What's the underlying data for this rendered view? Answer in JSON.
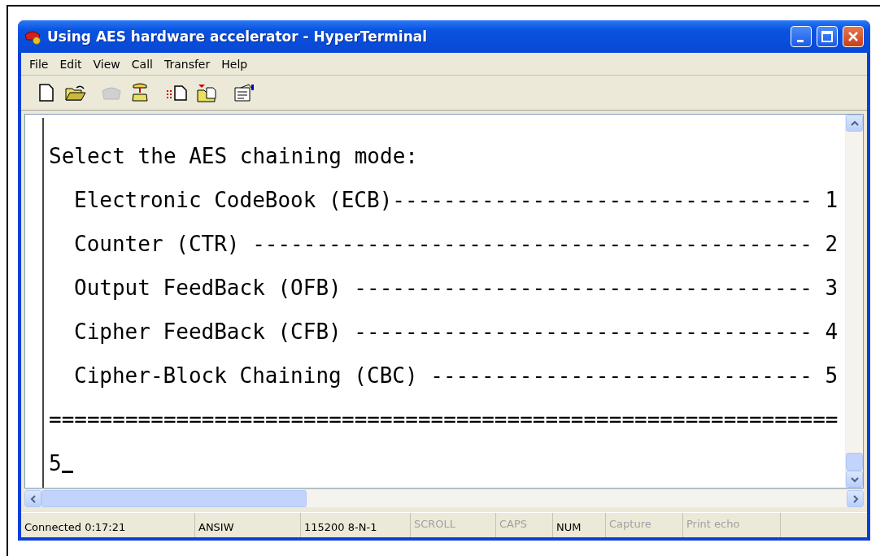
{
  "window": {
    "title": "Using AES hardware accelerator - HyperTerminal"
  },
  "menu": [
    "File",
    "Edit",
    "View",
    "Call",
    "Transfer",
    "Help"
  ],
  "toolbar": [
    {
      "kind": "new",
      "disabled": false
    },
    {
      "kind": "open",
      "disabled": false
    },
    {
      "kind": "disconnect",
      "disabled": true
    },
    {
      "kind": "call",
      "disabled": false
    },
    {
      "kind": "send",
      "disabled": false
    },
    {
      "kind": "receive",
      "disabled": false
    },
    {
      "kind": "properties",
      "disabled": false
    }
  ],
  "terminal": {
    "lines": [
      {
        "kind": "heading",
        "text": "Select the AES chaining mode:"
      },
      {
        "kind": "option",
        "text": "Electronic CodeBook (ECB)--------------------------------- 1"
      },
      {
        "kind": "option",
        "text": "Counter (CTR) -------------------------------------------- 2"
      },
      {
        "kind": "option",
        "text": "Output FeedBack (OFB) ------------------------------------ 3"
      },
      {
        "kind": "option",
        "text": "Cipher FeedBack (CFB) ------------------------------------ 4"
      },
      {
        "kind": "option",
        "text": "Cipher-Block Chaining (CBC) ------------------------------ 5"
      },
      {
        "kind": "rule",
        "text": "=============================================================="
      },
      {
        "kind": "input",
        "text": "5",
        "cursor": true
      }
    ]
  },
  "status_bar": [
    {
      "text": "Connected 0:17:21",
      "active": true
    },
    {
      "text": "ANSIW",
      "active": true
    },
    {
      "text": "115200 8-N-1",
      "active": true
    },
    {
      "text": "SCROLL",
      "active": false
    },
    {
      "text": "CAPS",
      "active": false
    },
    {
      "text": "NUM",
      "active": true
    },
    {
      "text": "Capture",
      "active": false
    },
    {
      "text": "Print echo",
      "active": false
    }
  ]
}
